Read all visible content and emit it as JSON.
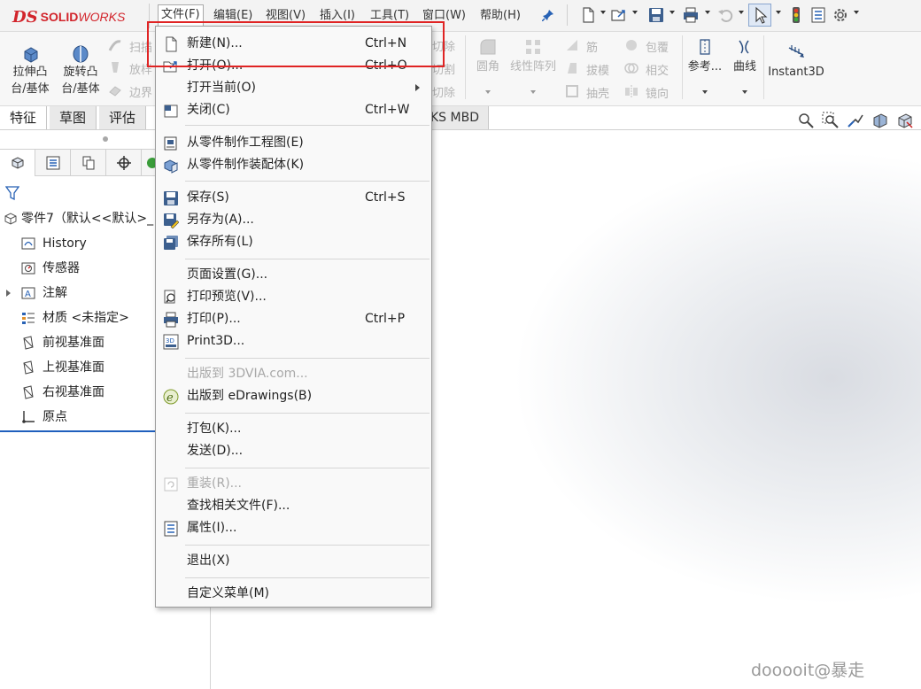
{
  "app": {
    "logo_ds": "DS",
    "logo_solid": "SOLID",
    "logo_works": "WORKS",
    "brand_color": "#d2242b"
  },
  "menubar": {
    "items": [
      {
        "label": "文件(F)"
      },
      {
        "label": "编辑(E)"
      },
      {
        "label": "视图(V)"
      },
      {
        "label": "插入(I)"
      },
      {
        "label": "工具(T)"
      },
      {
        "label": "窗口(W)"
      },
      {
        "label": "帮助(H)"
      }
    ]
  },
  "ribbon": {
    "extrude_line1": "拉伸凸",
    "extrude_line2": "台/基体",
    "revolve_line1": "旋转凸",
    "revolve_line2": "台/基体",
    "sweep": "扫描",
    "loft": "放样",
    "boundary": "边界",
    "cut1": "切除",
    "cut2": "切割",
    "cut3": "切除",
    "fillet": "圆角",
    "linear_pattern": "线性阵列",
    "rib": "筋",
    "draft": "拔模",
    "shell": "抽壳",
    "wrap": "包覆",
    "intersect": "相交",
    "mirror": "镜向",
    "reference": "参考...",
    "curves": "曲线",
    "instant3d": "Instant3D"
  },
  "tabs": {
    "features": "特征",
    "sketch": "草图",
    "evaluate": "评估",
    "mbd": "KS MBD"
  },
  "tree": {
    "part": "零件7（默认<<默认>_",
    "history": "History",
    "sensors": "传感器",
    "annotations": "注解",
    "material": "材质 <未指定>",
    "front_plane": "前视基准面",
    "top_plane": "上视基准面",
    "right_plane": "右视基准面",
    "origin": "原点"
  },
  "file_menu": {
    "new": {
      "label": "新建(N)...",
      "shortcut": "Ctrl+N"
    },
    "open": {
      "label": "打开(O)...",
      "shortcut": "Ctrl+O"
    },
    "open_current": {
      "label": "打开当前(O)"
    },
    "close": {
      "label": "关闭(C)",
      "shortcut": "Ctrl+W"
    },
    "make_drawing": {
      "label": "从零件制作工程图(E)"
    },
    "make_assembly": {
      "label": "从零件制作装配体(K)"
    },
    "save": {
      "label": "保存(S)",
      "shortcut": "Ctrl+S"
    },
    "save_as": {
      "label": "另存为(A)..."
    },
    "save_all": {
      "label": "保存所有(L)"
    },
    "page_setup": {
      "label": "页面设置(G)..."
    },
    "print_preview": {
      "label": "打印预览(V)..."
    },
    "print": {
      "label": "打印(P)...",
      "shortcut": "Ctrl+P"
    },
    "print3d": {
      "label": "Print3D..."
    },
    "publish_3dvia": {
      "label": "出版到 3DVIA.com..."
    },
    "publish_edrawings": {
      "label": "出版到 eDrawings(B)"
    },
    "pack_go": {
      "label": "打包(K)..."
    },
    "send": {
      "label": "发送(D)..."
    },
    "reload": {
      "label": "重装(R)..."
    },
    "find_references": {
      "label": "查找相关文件(F)..."
    },
    "properties": {
      "label": "属性(I)..."
    },
    "exit": {
      "label": "退出(X)"
    },
    "customize_menu": {
      "label": "自定义菜单(M)"
    }
  },
  "watermark": "dooooit@暴走",
  "colors": {
    "highlight_box": "#e02424",
    "selection_blue": "#1f5fbd"
  }
}
